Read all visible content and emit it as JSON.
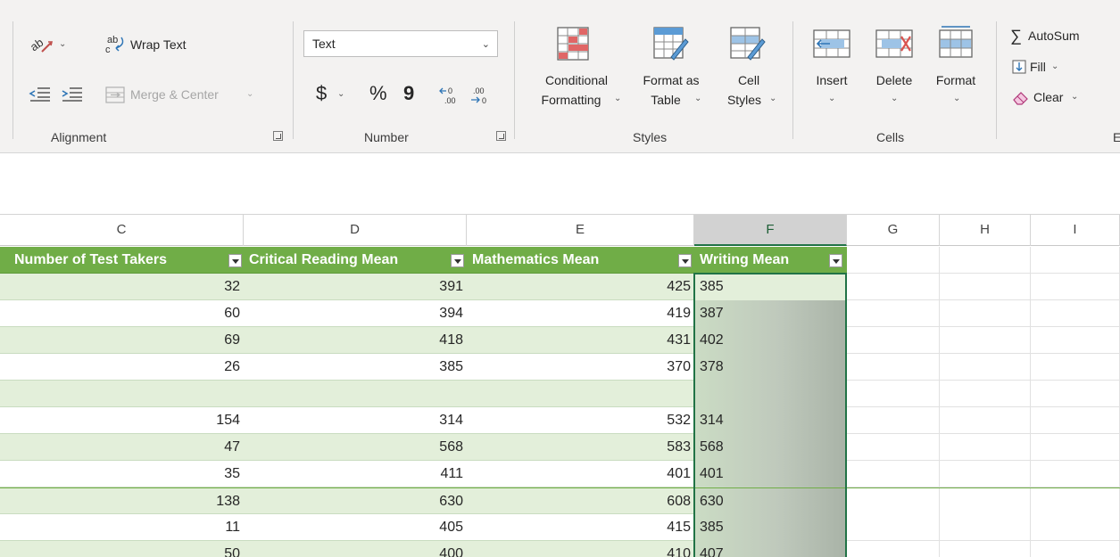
{
  "ribbon": {
    "alignment": {
      "wrap_text": "Wrap Text",
      "merge_center": "Merge & Center",
      "group_label": "Alignment"
    },
    "number": {
      "format_value": "Text",
      "currency": "$",
      "percent": "%",
      "comma": "9",
      "group_label": "Number"
    },
    "styles": {
      "conditional_formatting": [
        "Conditional",
        "Formatting"
      ],
      "format_as_table": [
        "Format as",
        "Table"
      ],
      "cell_styles": [
        "Cell",
        "Styles"
      ],
      "group_label": "Styles"
    },
    "cells": {
      "insert": "Insert",
      "delete": "Delete",
      "format": "Format",
      "group_label": "Cells"
    },
    "editing": {
      "autosum": "AutoSum",
      "fill": "Fill",
      "clear": "Clear",
      "group_label_partial": "E"
    }
  },
  "columns": [
    "C",
    "D",
    "E",
    "F",
    "G",
    "H",
    "I"
  ],
  "selected_column": "F",
  "table": {
    "headers": [
      "Number of Test Takers",
      "Critical Reading Mean",
      "Mathematics Mean",
      "Writing Mean"
    ],
    "rows": [
      [
        "32",
        "391",
        "425",
        "385"
      ],
      [
        "60",
        "394",
        "419",
        "387"
      ],
      [
        "69",
        "418",
        "431",
        "402"
      ],
      [
        "26",
        "385",
        "370",
        "378"
      ],
      [
        "",
        "",
        "",
        ""
      ],
      [
        "154",
        "314",
        "532",
        "314"
      ],
      [
        "47",
        "568",
        "583",
        "568"
      ],
      [
        "35",
        "411",
        "401",
        "401"
      ],
      [
        "138",
        "630",
        "608",
        "630"
      ],
      [
        "11",
        "405",
        "415",
        "385"
      ],
      [
        "50",
        "400",
        "410",
        "407"
      ]
    ]
  },
  "colors": {
    "header_fill": "#70ad47",
    "band_fill": "#e3efda",
    "selection_border": "#217346"
  }
}
